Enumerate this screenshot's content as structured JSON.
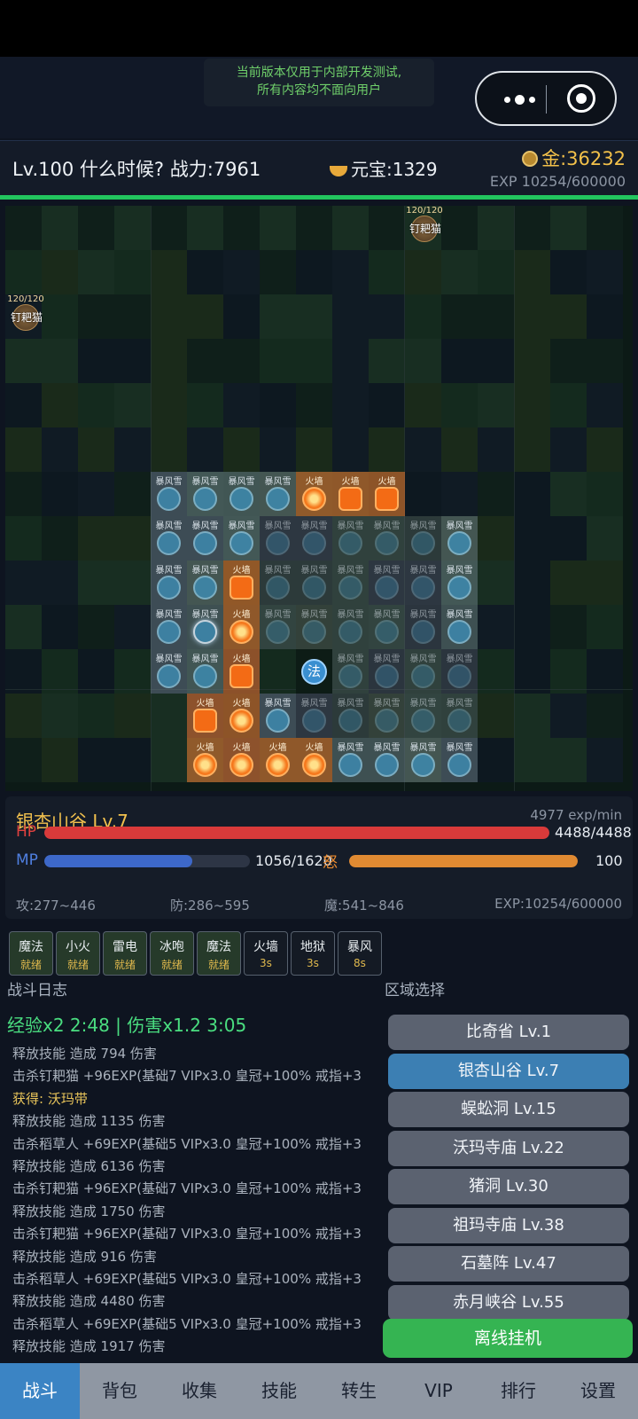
{
  "notice": {
    "line1": "当前版本仅用于内部开发测试,",
    "line2": "所有内容均不面向用户"
  },
  "header": {
    "player": "Lv.100 什么时候?  战力:7961",
    "ingot": "元宝:1329",
    "gold": "金:36232",
    "exp": "EXP 10254/600000"
  },
  "battlefield": {
    "enemies": [
      {
        "hp": "120/120",
        "name": "钉耙猫"
      },
      {
        "hp": "120/120",
        "name": "钉耙猫"
      }
    ],
    "skill_labels": {
      "ice": "暴风雪",
      "fire": "火墙"
    },
    "mage_label": "法"
  },
  "area": {
    "name": "银杏山谷 Lv.7",
    "exp_rate": "4977 exp/min",
    "hp_label": "HP",
    "hp_value": "4488/4488",
    "hp_fraction": 1.0,
    "mp_label": "MP",
    "mp_value": "1056/1620",
    "mp_fraction": 0.72,
    "rage_label": "怒",
    "rage_value": "100",
    "rage_fraction": 1.0,
    "attack": "攻:277~446",
    "defense": "防:286~595",
    "magic": "魔:541~846",
    "exp": "EXP:10254/600000"
  },
  "skills": [
    {
      "name": "魔法",
      "status": "就绪",
      "ready": true
    },
    {
      "name": "小火",
      "status": "就绪",
      "ready": true
    },
    {
      "name": "雷电",
      "status": "就绪",
      "ready": true
    },
    {
      "name": "冰咆",
      "status": "就绪",
      "ready": true
    },
    {
      "name": "魔法",
      "status": "就绪",
      "ready": true
    },
    {
      "name": "火墙",
      "status": "3s",
      "ready": false
    },
    {
      "name": "地狱",
      "status": "3s",
      "ready": false
    },
    {
      "name": "暴风",
      "status": "8s",
      "ready": false
    }
  ],
  "log": {
    "title": "战斗日志",
    "buff": "经验x2 2:48 | 伤害x1.2 3:05",
    "lines": [
      {
        "text": "释放技能 造成 794 伤害",
        "type": "normal"
      },
      {
        "text": "击杀钉耙猫 +96EXP(基础7 VIPx3.0 皇冠+100% 戒指+3",
        "type": "normal"
      },
      {
        "text": "获得: 沃玛带",
        "type": "loot"
      },
      {
        "text": "释放技能 造成 1135 伤害",
        "type": "normal"
      },
      {
        "text": "击杀稻草人 +69EXP(基础5 VIPx3.0 皇冠+100% 戒指+3",
        "type": "normal"
      },
      {
        "text": "释放技能 造成 6136 伤害",
        "type": "normal"
      },
      {
        "text": "击杀钉耙猫 +96EXP(基础7 VIPx3.0 皇冠+100% 戒指+3",
        "type": "normal"
      },
      {
        "text": "释放技能 造成 1750 伤害",
        "type": "normal"
      },
      {
        "text": "击杀钉耙猫 +96EXP(基础7 VIPx3.0 皇冠+100% 戒指+3",
        "type": "normal"
      },
      {
        "text": "释放技能 造成 916 伤害",
        "type": "normal"
      },
      {
        "text": "击杀稻草人 +69EXP(基础5 VIPx3.0 皇冠+100% 戒指+3",
        "type": "normal"
      },
      {
        "text": "释放技能 造成 4480 伤害",
        "type": "normal"
      },
      {
        "text": "击杀稻草人 +69EXP(基础5 VIPx3.0 皇冠+100% 戒指+3",
        "type": "normal"
      },
      {
        "text": "释放技能 造成 1917 伤害",
        "type": "normal"
      }
    ]
  },
  "zones": {
    "title": "区域选择",
    "items": [
      {
        "label": "比奇省 Lv.1",
        "active": false
      },
      {
        "label": "银杏山谷 Lv.7",
        "active": true
      },
      {
        "label": "蜈蚣洞 Lv.15",
        "active": false
      },
      {
        "label": "沃玛寺庙 Lv.22",
        "active": false
      },
      {
        "label": "猪洞 Lv.30",
        "active": false
      },
      {
        "label": "祖玛寺庙 Lv.38",
        "active": false
      },
      {
        "label": "石墓阵 Lv.47",
        "active": false
      },
      {
        "label": "赤月峡谷 Lv.55",
        "active": false
      }
    ],
    "offline": "离线挂机"
  },
  "tabs": [
    {
      "label": "战斗",
      "active": true
    },
    {
      "label": "背包",
      "active": false
    },
    {
      "label": "收集",
      "active": false
    },
    {
      "label": "技能",
      "active": false
    },
    {
      "label": "转生",
      "active": false
    },
    {
      "label": "VIP",
      "active": false
    },
    {
      "label": "排行",
      "active": false
    },
    {
      "label": "设置",
      "active": false
    }
  ],
  "colors": {
    "hp": "#d93a3a",
    "mp": "#3d68c9",
    "rage": "#e08a32",
    "exp_line": "#22c55e",
    "accent": "#3b84c4"
  }
}
